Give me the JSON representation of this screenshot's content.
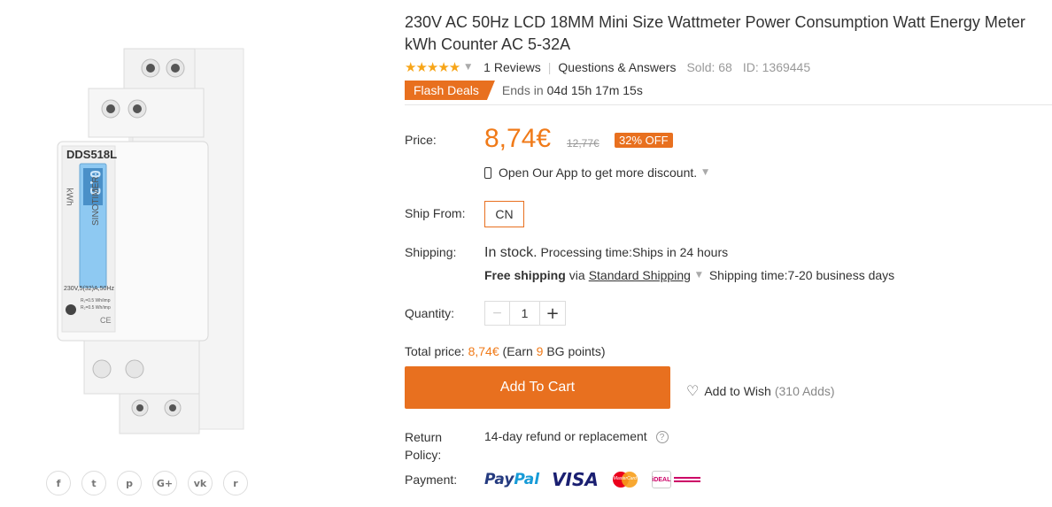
{
  "product": {
    "title": "230V AC 50Hz LCD 18MM Mini Size Wattmeter Power Consumption Watt Energy Meter kWh Counter AC 5-32A",
    "image": {
      "model_text": "DDS518L",
      "brand_text": "SINOTIMER",
      "unit_text": "kWh",
      "rating_text": "230V,5(32)A,50Hz",
      "imp_text_1": "R₁=0.5 Wh/imp",
      "imp_text_2": "R₂=0.5 Wh/imp",
      "ce_mark": "CE",
      "display_digits": "0.3"
    },
    "rating": {
      "stars": "★★★★★",
      "stars_value": 5,
      "reviews": "1 Reviews",
      "qa": "Questions & Answers",
      "sold": "Sold: 68",
      "id": "ID: 1369445"
    },
    "flash": {
      "label": "Flash Deals",
      "ends_label": "Ends in",
      "time": "04d 15h 17m 15s"
    },
    "price": {
      "label": "Price:",
      "current": "8,74€",
      "original": "12,77€",
      "discount": "32% OFF"
    },
    "app_promo": "Open Our App to get more discount.",
    "ship_from": {
      "label": "Ship From:",
      "value": "CN"
    },
    "shipping": {
      "label": "Shipping:",
      "stock": "In stock.",
      "processing": "Processing time:Ships in 24 hours",
      "free": "Free shipping",
      "via": "via",
      "method": "Standard Shipping",
      "time": "Shipping time:7-20 business days"
    },
    "quantity": {
      "label": "Quantity:",
      "minus": "−",
      "value": "1",
      "plus": "+"
    },
    "total": {
      "label": "Total price:",
      "amount": "8,74€",
      "earn_prefix": "(Earn",
      "points": "9",
      "earn_suffix": "BG points)"
    },
    "actions": {
      "cart": "Add To Cart",
      "wish": "Add to Wish",
      "wish_count": "(310 Adds)"
    },
    "return_policy": {
      "label_line1": "Return",
      "label_line2": "Policy:",
      "value": "14-day refund or replacement",
      "help": "?"
    },
    "payment": {
      "label": "Payment:",
      "paypal_1": "Pay",
      "paypal_2": "Pal",
      "visa": "VISA",
      "mastercard": "MasterCard",
      "ideal": "iDEAL"
    }
  },
  "social": [
    {
      "icon": "facebook-icon",
      "glyph": "f"
    },
    {
      "icon": "twitter-icon",
      "glyph": "t"
    },
    {
      "icon": "pinterest-icon",
      "glyph": "p"
    },
    {
      "icon": "google-plus-icon",
      "glyph": "G+"
    },
    {
      "icon": "vk-icon",
      "glyph": "vk"
    },
    {
      "icon": "reddit-icon",
      "glyph": "r"
    }
  ],
  "colors": {
    "accent": "#e8701f",
    "price": "#f07a18",
    "star": "#f7a518"
  }
}
